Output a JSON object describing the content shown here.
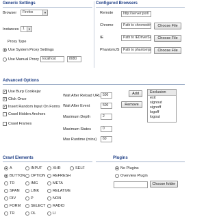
{
  "generic": {
    "title": "Generic Settings",
    "browser_label": "Browser",
    "browser_value": "Firefox",
    "instances_label": "Instances",
    "instances_value": "1",
    "proxy_type_label": "Proxy Type",
    "system_proxy_label": "Use System Proxy Settings",
    "manual_proxy_label": "Use Manual Proxy",
    "proxy_host": "localhost",
    "proxy_port": "8080"
  },
  "configured": {
    "title": "Configured Browsers",
    "remote_label": "Remote",
    "remote_value": "http://server:port/",
    "chrome_label": "Chrome",
    "chrome_value": "Path to chromedriver.exe",
    "ie_label": "IE",
    "ie_value": "Path to IEDriverServer.exe",
    "phantom_label": "PhantomJS",
    "phantom_value": "Path to phantomjs.exe",
    "choose_file_label": "Choose File"
  },
  "advanced": {
    "title": "Advanced Options",
    "checks": [
      {
        "label": "Use Burp Cookiejar",
        "checked": true
      },
      {
        "label": "Click Once",
        "checked": true
      },
      {
        "label": "Insert Random Input On Forms",
        "checked": true
      },
      {
        "label": "Crawl Hidden Anchors",
        "checked": false
      },
      {
        "label": "Crawl Frames",
        "checked": false
      }
    ],
    "wait_reload_label": "Wait After Reload URL",
    "wait_reload_value": "500",
    "wait_event_label": "Wait After Event",
    "wait_event_value": "500",
    "max_depth_label": "Maximum Depth",
    "max_depth_value": "2",
    "max_states_label": "Maximum States",
    "max_states_value": "0",
    "max_runtime_label": "Max Runtime (mins)",
    "max_runtime_value": "60",
    "add_label": "Add",
    "remove_label": "Remove",
    "exclusion_header": "Exclusion",
    "exclusions": [
      "exit",
      "signout",
      "signoff",
      "logoff",
      "logout"
    ]
  },
  "crawl": {
    "title": "Crawl Elements",
    "items": [
      {
        "label": "A",
        "checked": true
      },
      {
        "label": "INPUT",
        "checked": false
      },
      {
        "label": "XHR",
        "checked": false
      },
      {
        "label": "SELF",
        "checked": false
      },
      {
        "label": "BUTTON",
        "checked": true
      },
      {
        "label": "OPTION",
        "checked": false
      },
      {
        "label": "REFRESH",
        "checked": false
      },
      {
        "label": "TD",
        "checked": false
      },
      {
        "label": "IMG",
        "checked": false
      },
      {
        "label": "META",
        "checked": false
      },
      {
        "label": "SPAN",
        "checked": false
      },
      {
        "label": "LINK",
        "checked": false
      },
      {
        "label": "RELATIVE",
        "checked": false
      },
      {
        "label": "DIV",
        "checked": false
      },
      {
        "label": "P",
        "checked": false
      },
      {
        "label": "NON",
        "checked": false
      },
      {
        "label": "FORM",
        "checked": false
      },
      {
        "label": "SELECT",
        "checked": false
      },
      {
        "label": "RADIO",
        "checked": false
      },
      {
        "label": "TR",
        "checked": false
      },
      {
        "label": "OL",
        "checked": false
      },
      {
        "label": "LI",
        "checked": false
      }
    ]
  },
  "plugins": {
    "title": "Plugins",
    "no_plugins_label": "No Plugins",
    "overview_label": "Overview Plugin",
    "choose_folder_label": "Choose folder"
  }
}
